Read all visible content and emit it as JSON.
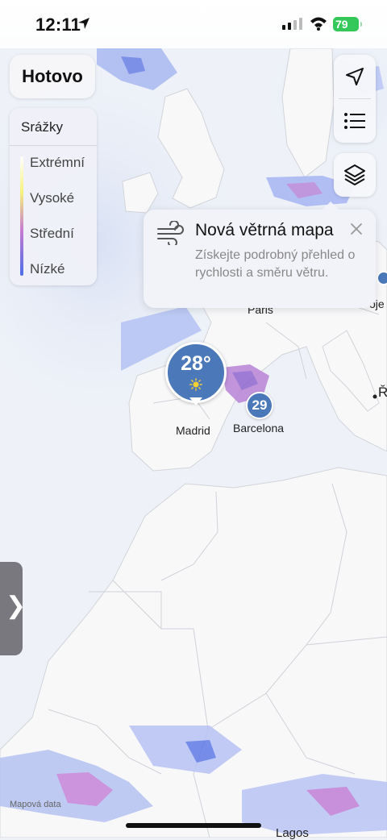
{
  "status_bar": {
    "time": "12:11",
    "battery": "79",
    "battery_color": "#34c759",
    "icons": [
      "location-arrow-icon",
      "cellular-signal-icon",
      "wifi-icon",
      "battery-icon"
    ]
  },
  "toolbar": {
    "done_label": "Hotovo"
  },
  "legend": {
    "title": "Srážky",
    "levels": [
      "Extrémní",
      "Vysoké",
      "Střední",
      "Nízké"
    ]
  },
  "map_controls": {
    "icons": [
      "location-arrow-icon",
      "list-icon",
      "layers-icon"
    ]
  },
  "tip": {
    "icon": "wind-icon",
    "title": "Nová větrná mapa",
    "body": "Získejte podrobný přehled o rychlosti a směru větru."
  },
  "map": {
    "cities": {
      "madrid": "Madrid",
      "barcelona": "Barcelona",
      "paris": "Paris",
      "lagos": "Lagos",
      "edge_1": "oje",
      "edge_2": "Ř"
    },
    "current_pin": {
      "temperature": "28°",
      "icon": "sun-icon"
    },
    "secondary_pin": {
      "temperature": "29"
    },
    "precip_colors": [
      "#4d6ee8",
      "#c77bd0",
      "#8a7be0"
    ],
    "attribution": "Mapová data"
  },
  "side_tab": {
    "icon": "chevron-right-icon",
    "glyph": "❯"
  }
}
